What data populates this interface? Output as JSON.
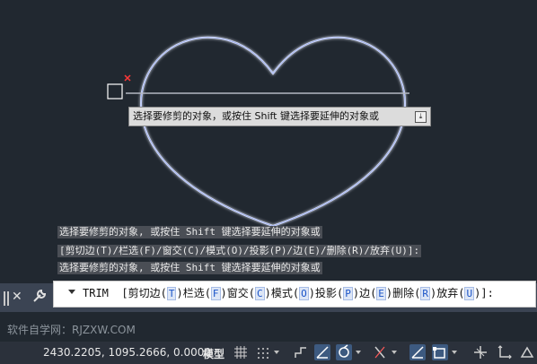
{
  "tooltip": {
    "text": "选择要修剪的对象，或按住 Shift 键选择要延伸的对象或",
    "icon": "download-icon"
  },
  "history": [
    "选择要修剪的对象, 或按住 Shift 键选择要延伸的对象或",
    " [剪切边(T)/栏选(F)/窗交(C)/模式(O)/投影(P)/边(E)/删除(R)/放弃(U)]:",
    "选择要修剪的对象, 或按住 Shift 键选择要延伸的对象或"
  ],
  "command": {
    "name": "TRIM",
    "options": [
      "剪切边(T)",
      "栏选(F)",
      "窗交(C)",
      "模式(O)",
      "投影(P)",
      "边(E)",
      "删除(R)",
      "放弃(U)"
    ],
    "suffix": ":"
  },
  "watermark": "软件自学网：RJZXW.COM",
  "status": {
    "coords": "2430.2205, 1095.2666, 0.0000",
    "model": "模型"
  },
  "colors": {
    "background": "#212830",
    "heart": "#6c86e6",
    "glow": "#a9c2ff",
    "line": "#b8c6ff",
    "marker": "#ff3838"
  }
}
